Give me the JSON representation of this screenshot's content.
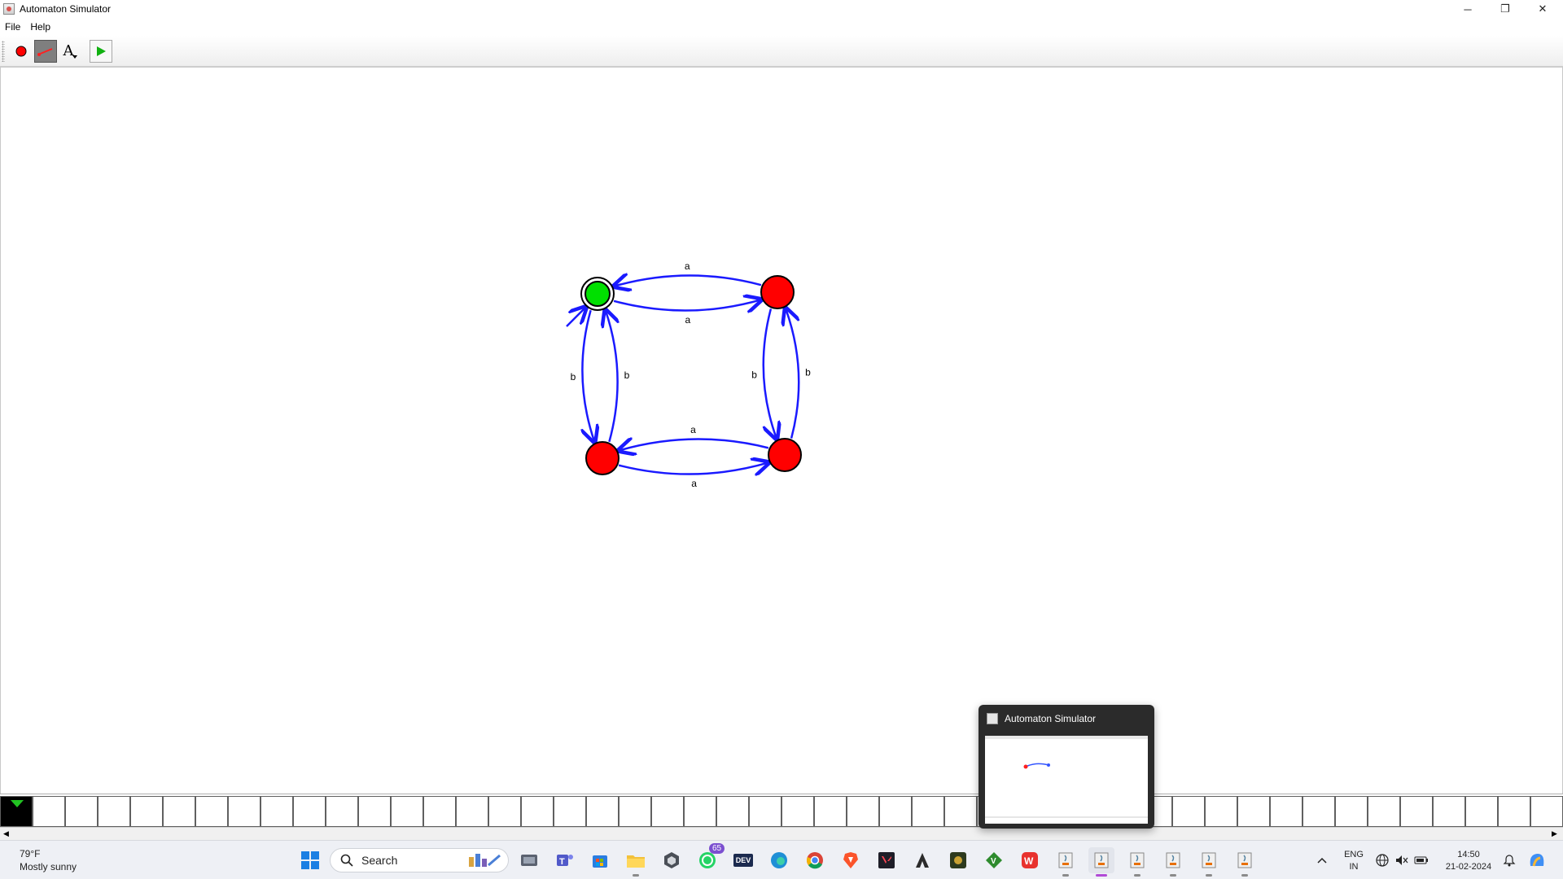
{
  "window": {
    "title": "Automaton Simulator",
    "minimize": "─",
    "restore": "❐",
    "close": "✕"
  },
  "menu": {
    "file": "File",
    "help": "Help"
  },
  "toolbar": {
    "tools": [
      "state-tool",
      "transition-tool",
      "label-tool",
      "run-tool"
    ],
    "label_tool_glyph": "A"
  },
  "automaton": {
    "states": [
      {
        "id": "q0",
        "fill": "#00e000",
        "initial": true,
        "accepting": true
      },
      {
        "id": "q1",
        "fill": "#ff0000"
      },
      {
        "id": "q2",
        "fill": "#ff0000"
      },
      {
        "id": "q3",
        "fill": "#ff0000"
      }
    ],
    "transitions": [
      {
        "from": "q0",
        "to": "q1",
        "label": "a"
      },
      {
        "from": "q1",
        "to": "q0",
        "label": "a"
      },
      {
        "from": "q0",
        "to": "q2",
        "label": "b"
      },
      {
        "from": "q2",
        "to": "q0",
        "label": "b"
      },
      {
        "from": "q1",
        "to": "q3",
        "label": "b"
      },
      {
        "from": "q3",
        "to": "q1",
        "label": "b"
      },
      {
        "from": "q2",
        "to": "q3",
        "label": "a"
      },
      {
        "from": "q3",
        "to": "q2",
        "label": "a"
      }
    ],
    "edge_color": "#1a1aff"
  },
  "tape": {
    "cell_count": 48,
    "head_index": 0
  },
  "taskbar": {
    "weather_temp": "79°F",
    "weather_desc": "Mostly sunny",
    "search_placeholder": "Search",
    "whatsapp_badge": "65",
    "lang_top": "ENG",
    "lang_bottom": "IN",
    "time": "14:50",
    "date": "21-02-2024",
    "dev_label": "DEV"
  },
  "preview": {
    "title": "Automaton Simulator"
  }
}
